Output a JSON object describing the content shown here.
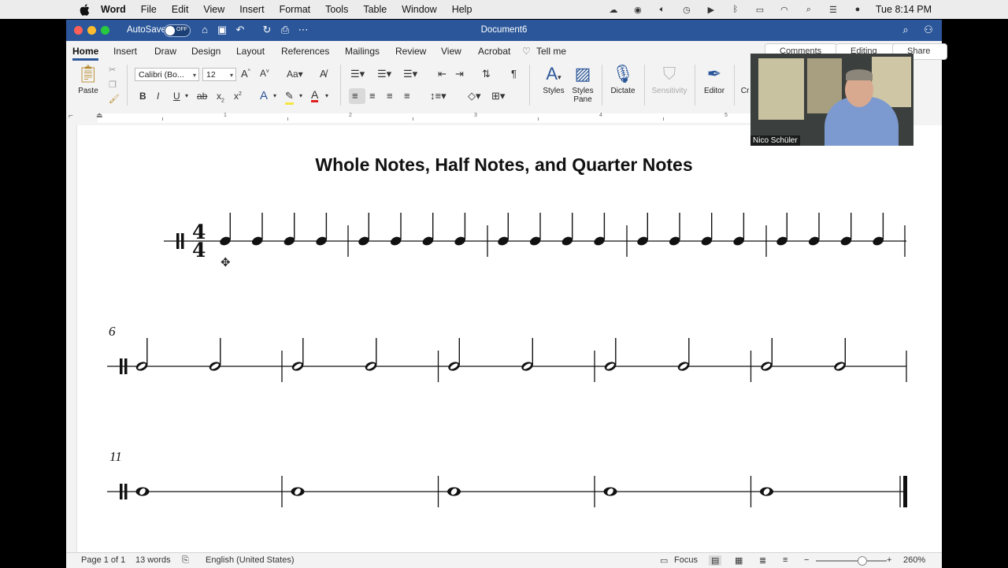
{
  "menubar": {
    "apple": "",
    "items": [
      "Word",
      "File",
      "Edit",
      "View",
      "Insert",
      "Format",
      "Tools",
      "Table",
      "Window",
      "Help"
    ],
    "clock": "Tue 8:14 PM",
    "tray_icons": [
      "creative-cloud-icon",
      "sync-icon",
      "volume-icon",
      "time-machine-icon",
      "play-icon",
      "bluetooth-icon",
      "battery-icon",
      "wifi-icon",
      "search-icon",
      "control-center-icon",
      "siri-icon"
    ]
  },
  "titlebar": {
    "autosave_label": "AutoSave",
    "autosave_state": "OFF",
    "doc_title": "Document6"
  },
  "tabs": [
    "Home",
    "Insert",
    "Draw",
    "Design",
    "Layout",
    "References",
    "Mailings",
    "Review",
    "View",
    "Acrobat"
  ],
  "tell_me": "Tell me",
  "right_buttons": {
    "comments": "Comments",
    "editing": "Editing",
    "share": "Share"
  },
  "ribbon": {
    "paste_label": "Paste",
    "font_name": "Calibri (Bo...",
    "font_size": "12",
    "styles_label": "Styles",
    "styles_pane_label": "Styles Pane",
    "dictate_label": "Dictate",
    "sensitivity_label": "Sensitivity",
    "editor_label": "Editor",
    "create_label": "Cr"
  },
  "ruler_numbers": [
    "1",
    "2",
    "3",
    "4",
    "5"
  ],
  "document": {
    "heading": "Whole Notes, Half Notes, and Quarter Notes",
    "time_signature": {
      "top": "4",
      "bottom": "4"
    },
    "system_numbers": [
      "6",
      "11"
    ],
    "systems": [
      {
        "note_type": "quarter",
        "measures": 5,
        "notes_per_measure": 4
      },
      {
        "note_type": "half",
        "measures": 5,
        "notes_per_measure": 2
      },
      {
        "note_type": "whole",
        "measures": 5,
        "notes_per_measure": 1,
        "final_barline": true
      }
    ]
  },
  "statusbar": {
    "page": "Page 1 of 1",
    "words": "13 words",
    "language": "English (United States)",
    "focus": "Focus",
    "zoom": "260%"
  },
  "video": {
    "name": "Nico Schüler"
  }
}
